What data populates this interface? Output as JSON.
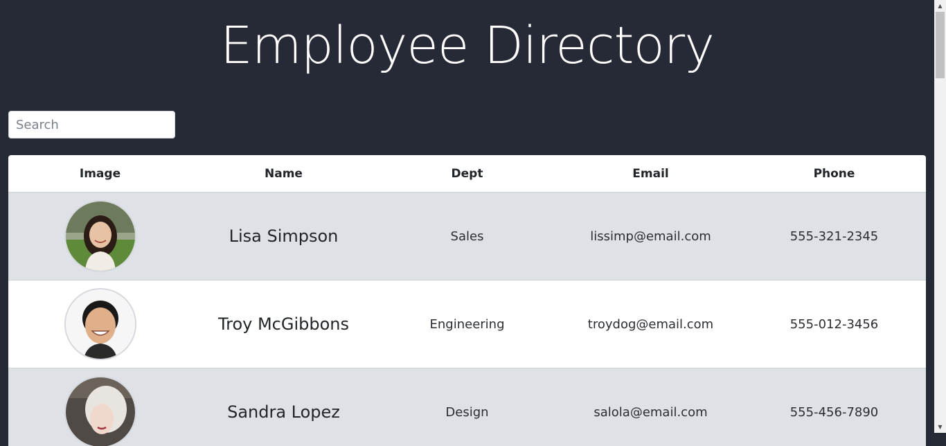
{
  "header": {
    "title": "Employee Directory"
  },
  "search": {
    "placeholder": "Search",
    "value": ""
  },
  "table": {
    "columns": [
      "Image",
      "Name",
      "Dept",
      "Email",
      "Phone"
    ],
    "rows": [
      {
        "image": "employee-photo-woman-dark-hair",
        "name": "Lisa Simpson",
        "dept": "Sales",
        "email": "lissimp@email.com",
        "phone": "555-321-2345"
      },
      {
        "image": "employee-photo-man-smiling",
        "name": "Troy McGibbons",
        "dept": "Engineering",
        "email": "troydog@email.com",
        "phone": "555-012-3456"
      },
      {
        "image": "employee-photo-woman-blonde",
        "name": "Sandra Lopez",
        "dept": "Design",
        "email": "salola@email.com",
        "phone": "555-456-7890"
      }
    ]
  },
  "colors": {
    "background": "#262936",
    "row_alt": "#dee1e6",
    "row_plain": "#ffffff"
  }
}
